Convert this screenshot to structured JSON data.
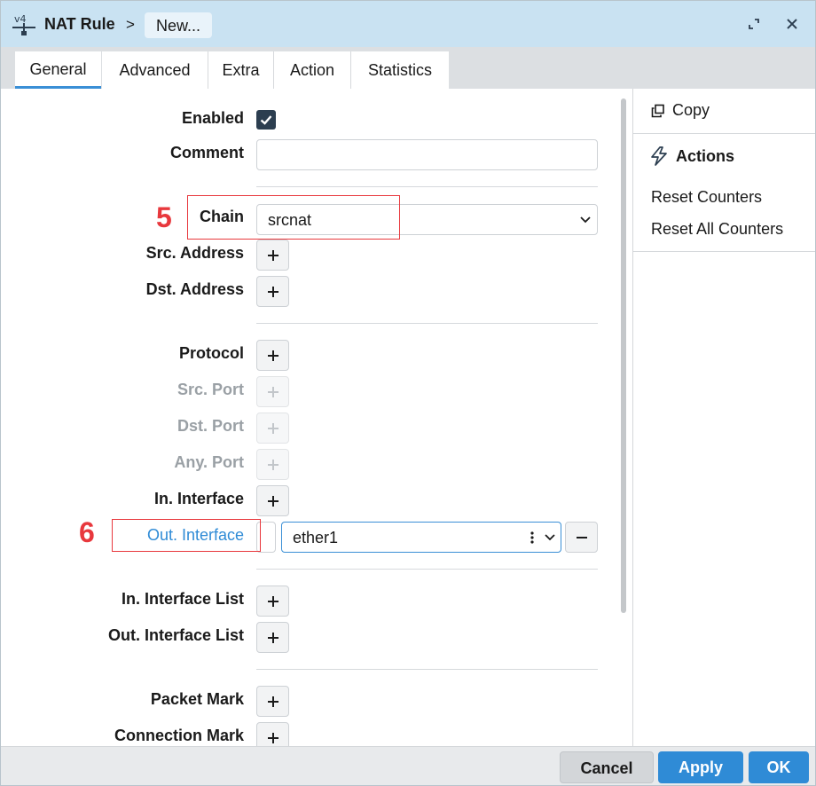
{
  "title": {
    "app": "NAT Rule",
    "separator": ">",
    "item": "New..."
  },
  "tabs": [
    "General",
    "Advanced",
    "Extra",
    "Action",
    "Statistics"
  ],
  "active_tab": "General",
  "form": {
    "enabled_label": "Enabled",
    "enabled_checked": true,
    "comment_label": "Comment",
    "comment_value": "",
    "chain_label": "Chain",
    "chain_value": "srcnat",
    "src_address_label": "Src. Address",
    "dst_address_label": "Dst. Address",
    "protocol_label": "Protocol",
    "src_port_label": "Src. Port",
    "dst_port_label": "Dst. Port",
    "any_port_label": "Any. Port",
    "in_interface_label": "In. Interface",
    "out_interface_label": "Out. Interface",
    "out_interface_value": "ether1",
    "in_interface_list_label": "In. Interface List",
    "out_interface_list_label": "Out. Interface List",
    "packet_mark_label": "Packet Mark",
    "connection_mark_label": "Connection Mark"
  },
  "annotations": {
    "chain_number": "5",
    "out_interface_number": "6",
    "color": "#e8383d"
  },
  "sidebar": {
    "copy_label": "Copy",
    "actions_title": "Actions",
    "reset_counters": "Reset Counters",
    "reset_all_counters": "Reset All Counters"
  },
  "footer": {
    "cancel": "Cancel",
    "apply": "Apply",
    "ok": "OK"
  },
  "colors": {
    "titlebar": "#c9e2f2",
    "accent": "#2f8bd6",
    "link_active": "#2f8bd6"
  }
}
